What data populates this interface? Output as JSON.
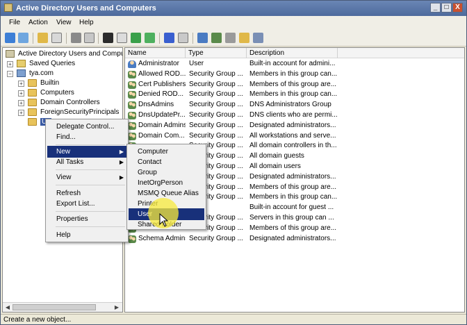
{
  "window": {
    "title": "Active Directory Users and Computers",
    "buttons": {
      "minimize": "_",
      "maximize": "□",
      "close": "X"
    }
  },
  "menubar": [
    "File",
    "Action",
    "View",
    "Help"
  ],
  "toolbar": {
    "icons": [
      "back-arrow-icon",
      "forward-arrow-icon",
      "up-folder-icon",
      "show-hide-tree-icon",
      "cut-icon",
      "copy-icon",
      "delete-icon",
      "properties-icon",
      "refresh-icon",
      "export-list-icon",
      "help-icon",
      "console-icon",
      "add-user-icon",
      "add-group-icon",
      "filter-icon",
      "add-ou-icon",
      "add-to-group-icon"
    ]
  },
  "tree": {
    "root": "Active Directory Users and Comput",
    "saved_queries": "Saved Queries",
    "domain": "tya.com",
    "children": [
      "Builtin",
      "Computers",
      "Domain Controllers",
      "ForeignSecurityPrincipals"
    ],
    "selected": "Us"
  },
  "list": {
    "columns": [
      "Name",
      "Type",
      "Description"
    ],
    "rows": [
      {
        "name": "Administrator",
        "type": "User",
        "desc": "Built-in account for admini...",
        "icon": "user"
      },
      {
        "name": "Allowed ROD...",
        "type": "Security Group ...",
        "desc": "Members in this group can...",
        "icon": "group"
      },
      {
        "name": "Cert Publishers",
        "type": "Security Group ...",
        "desc": "Members of this group are...",
        "icon": "group"
      },
      {
        "name": "Denied ROD...",
        "type": "Security Group ...",
        "desc": "Members in this group can...",
        "icon": "group"
      },
      {
        "name": "DnsAdmins",
        "type": "Security Group ...",
        "desc": "DNS Administrators Group",
        "icon": "group"
      },
      {
        "name": "DnsUpdatePr...",
        "type": "Security Group ...",
        "desc": "DNS clients who are permi...",
        "icon": "group"
      },
      {
        "name": "Domain Admins",
        "type": "Security Group ...",
        "desc": "Designated administrators...",
        "icon": "group"
      },
      {
        "name": "Domain Com...",
        "type": "Security Group ...",
        "desc": "All workstations and serve...",
        "icon": "group"
      },
      {
        "name": "",
        "type": "Security Group ...",
        "desc": "All domain controllers in th...",
        "icon": "group"
      },
      {
        "name": "",
        "type": "Security Group ...",
        "desc": "All domain guests",
        "icon": "group"
      },
      {
        "name": "",
        "type": "Security Group ...",
        "desc": "All domain users",
        "icon": "group"
      },
      {
        "name": "",
        "type": "Security Group ...",
        "desc": "Designated administrators...",
        "icon": "group"
      },
      {
        "name": "",
        "type": "Security Group ...",
        "desc": "Members of this group are...",
        "icon": "group"
      },
      {
        "name": "",
        "type": "Security Group ...",
        "desc": "Members in this group can...",
        "icon": "group"
      },
      {
        "name": "",
        "type": "",
        "desc": "Built-in account for guest ...",
        "icon": "user"
      },
      {
        "name": "",
        "type": "Security Group ...",
        "desc": "Servers in this group can ...",
        "icon": "group"
      },
      {
        "name": "",
        "type": "Security Group ...",
        "desc": "Members of this group are...",
        "icon": "group"
      },
      {
        "name": "Schema Admins",
        "type": "Security Group ...",
        "desc": "Designated administrators...",
        "icon": "group"
      }
    ]
  },
  "context_menu": {
    "items": [
      "Delegate Control...",
      "Find...",
      "New",
      "All Tasks",
      "View",
      "Refresh",
      "Export List...",
      "Properties",
      "Help"
    ],
    "highlighted": "New"
  },
  "submenu": {
    "items": [
      "Computer",
      "Contact",
      "Group",
      "InetOrgPerson",
      "MSMQ Queue Alias",
      "Printer",
      "User",
      "Shared Folder"
    ],
    "highlighted": "User"
  },
  "statusbar": {
    "text": "Create a new object..."
  },
  "colors": {
    "menu_highlight": "#18307a",
    "titlebar": "#4d6a9c",
    "cursor_highlight": "#f8eb3c"
  }
}
